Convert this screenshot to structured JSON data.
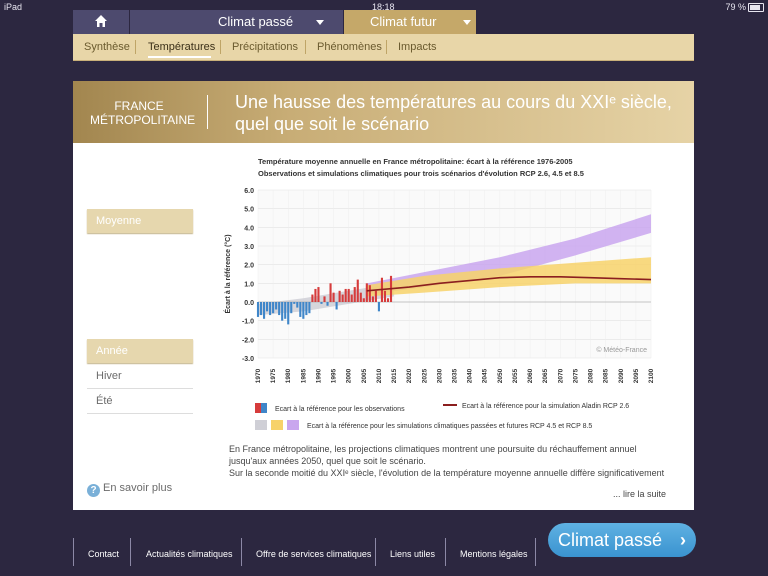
{
  "status": {
    "device": "iPad",
    "time": "18:18",
    "battery": "79 %"
  },
  "topnav": {
    "passe": "Climat passé",
    "futur": "Climat futur"
  },
  "tabs": [
    "Synthèse",
    "Températures",
    "Précipitations",
    "Phénomènes",
    "Impacts"
  ],
  "header": {
    "region_line1": "FRANCE",
    "region_line2": "MÉTROPOLITAINE",
    "title_line1": "Une hausse des températures au cours du XXIᵉ siècle,",
    "title_line2": "quel que soit le scénario"
  },
  "side": {
    "moyenne": "Moyenne",
    "annee": "Année",
    "hiver": "Hiver",
    "ete": "Été",
    "info": "En savoir plus"
  },
  "para": {
    "line1": "En France métropolitaine, les projections climatiques montrent une poursuite du réchauffement annuel jusqu'aux années 2050, quel que soit le scénario.",
    "line2": "Sur la seconde moitié du XXIᵉ siècle, l'évolution de la température moyenne annuelle diffère significativement",
    "more": "... lire la suite"
  },
  "footer": [
    "Contact",
    "Actualités climatiques",
    "Offre de services climatiques",
    "Liens utiles",
    "Mentions légales"
  ],
  "cta": "Climat passé",
  "colors": {
    "warm": "#d63b3b",
    "cold": "#3f86c9",
    "rcp26": "#cfcfd6",
    "rcp45": "#f7d26a",
    "rcp85": "#c9a6ee",
    "aladin": "#8b1f1f"
  },
  "chart_data": {
    "type": "area",
    "title": "Température moyenne annuelle en France métropolitaine: écart à la référence 1976-2005",
    "subtitle": "Observations et simulations climatiques pour trois scénarios d'évolution RCP 2.6, 4.5 et 8.5",
    "ylabel": "Écart à la référence (°C)",
    "ylim": [
      -3.0,
      6.0
    ],
    "yticks": [
      "6.0",
      "5.0",
      "4.0",
      "3.0",
      "2.0",
      "1.0",
      "0.0",
      "-1.0",
      "-2.0",
      "-3.0"
    ],
    "xticks": [
      "1970",
      "1975",
      "1980",
      "1985",
      "1990",
      "1995",
      "2000",
      "2005",
      "2010",
      "2015",
      "2020",
      "2025",
      "2030",
      "2035",
      "2040",
      "2045",
      "2050",
      "2055",
      "2060",
      "2065",
      "2070",
      "2075",
      "2080",
      "2085",
      "2090",
      "2095",
      "2100"
    ],
    "watermark": "© Météo-France",
    "observations": {
      "years": [
        1970,
        1971,
        1972,
        1973,
        1974,
        1975,
        1976,
        1977,
        1978,
        1979,
        1980,
        1981,
        1982,
        1983,
        1984,
        1985,
        1986,
        1987,
        1988,
        1989,
        1990,
        1991,
        1992,
        1993,
        1994,
        1995,
        1996,
        1997,
        1998,
        1999,
        2000,
        2001,
        2002,
        2003,
        2004,
        2005,
        2006,
        2007,
        2008,
        2009,
        2010,
        2011,
        2012,
        2013,
        2014
      ],
      "values": [
        -0.8,
        -0.7,
        -0.9,
        -0.5,
        -0.7,
        -0.6,
        -0.4,
        -0.7,
        -1.0,
        -0.9,
        -1.2,
        -0.6,
        -0.1,
        -0.3,
        -0.8,
        -0.9,
        -0.7,
        -0.6,
        0.4,
        0.7,
        0.8,
        -0.1,
        0.3,
        -0.2,
        1.0,
        0.5,
        -0.4,
        0.6,
        0.4,
        0.7,
        0.7,
        0.4,
        0.8,
        1.2,
        0.5,
        0.2,
        1.0,
        0.9,
        0.3,
        0.6,
        -0.5,
        1.3,
        0.6,
        0.2,
        1.4
      ]
    },
    "aladin_rcp26": {
      "x": [
        2006,
        2020,
        2030,
        2040,
        2050,
        2060,
        2070,
        2080,
        2090,
        2100
      ],
      "y": [
        0.6,
        0.8,
        1.0,
        1.15,
        1.3,
        1.35,
        1.35,
        1.3,
        1.25,
        1.2
      ]
    },
    "envelopes": [
      {
        "name": "RCP 2.6",
        "x": [
          1970,
          1985,
          2000,
          2015
        ],
        "low": [
          -0.7,
          -0.5,
          -0.1,
          0.3
        ],
        "high": [
          -0.1,
          0.2,
          0.6,
          1.0
        ]
      },
      {
        "name": "RCP 4.5",
        "x": [
          2006,
          2025,
          2050,
          2075,
          2100
        ],
        "low": [
          0.3,
          0.5,
          0.8,
          1.0,
          1.0
        ],
        "high": [
          0.9,
          1.4,
          1.8,
          2.1,
          2.4
        ]
      },
      {
        "name": "RCP 8.5",
        "x": [
          2006,
          2025,
          2050,
          2075,
          2100
        ],
        "low": [
          0.4,
          0.8,
          1.4,
          2.5,
          3.7
        ],
        "high": [
          1.0,
          1.6,
          2.4,
          3.4,
          4.7
        ]
      }
    ],
    "legend": [
      "Ecart à la référence pour les observations",
      "Ecart à la référence pour la simulation Aladin RCP 2.6",
      "Ecart à la référence pour les simulations climatiques passées et futures RCP 4.5 et RCP 8.5"
    ]
  }
}
